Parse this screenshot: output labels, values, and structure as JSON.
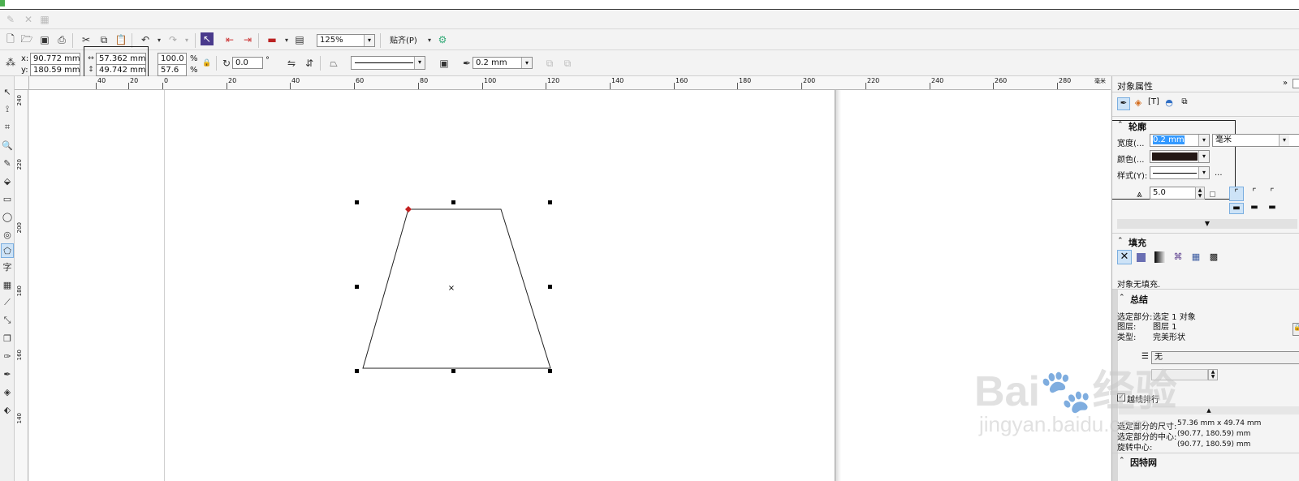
{
  "menubar": {
    "faded_icons": [
      "app-icon-1",
      "app-icon-2",
      "app-icon-3"
    ]
  },
  "toolbar": {
    "zoom": "125%",
    "snap_label": "贴齐(P)"
  },
  "propbar": {
    "x_label": "x:",
    "x_value": "90.772 mm",
    "y_label": "y:",
    "y_value": "180.59 mm",
    "width_value": "57.362 mm",
    "height_value": "49.742 mm",
    "scale_w": "100.0",
    "scale_h": "57.6",
    "percent": "%",
    "rotation": "0.0",
    "degree": "°",
    "outline_width": "0.2 mm"
  },
  "ruler": {
    "h_ticks": [
      "40",
      "20",
      "0",
      "20",
      "40",
      "60",
      "80",
      "100",
      "120",
      "140",
      "160",
      "180",
      "200",
      "220",
      "240",
      "260",
      "280"
    ],
    "h_unit": "毫米",
    "v_ticks": [
      "240",
      "220",
      "200",
      "180",
      "160",
      "140"
    ]
  },
  "docker": {
    "title": "对象属性",
    "outline": {
      "header": "轮廓",
      "width_label": "宽度(...",
      "width_value": "0.2 mm",
      "unit": "毫米",
      "color_label": "颜色(...",
      "color_value": "#231815",
      "style_label": "样式(Y):",
      "more": "...",
      "miter_value": "5.0"
    },
    "fill": {
      "header": "填充",
      "status": "对象无填充."
    },
    "summary": {
      "header": "总结",
      "selection_label": "选定部分:",
      "selection_value": "选定 1 对象",
      "layer_label": "图层:",
      "layer_value": "图层 1",
      "type_label": "类型:",
      "type_value": "完美形状",
      "wrap_value": "无",
      "checkbox_label": "越线排行",
      "size_label": "选定部分的尺寸:",
      "size_value": "57.36 mm x 49.74 mm",
      "center_label": "选定部分的中心:",
      "center_value": "(90.77, 180.59) mm",
      "rot_label": "旋转中心:",
      "rot_value": "(90.77, 180.59) mm"
    },
    "internet": {
      "header": "因特网"
    }
  },
  "colors": {
    "accent_selection": "#3399ff",
    "node_red": "#d02020",
    "outline_color": "#231815"
  },
  "watermark": {
    "brand": "Bai",
    "brand2": "经验",
    "url": "jingyan.baidu.com"
  }
}
